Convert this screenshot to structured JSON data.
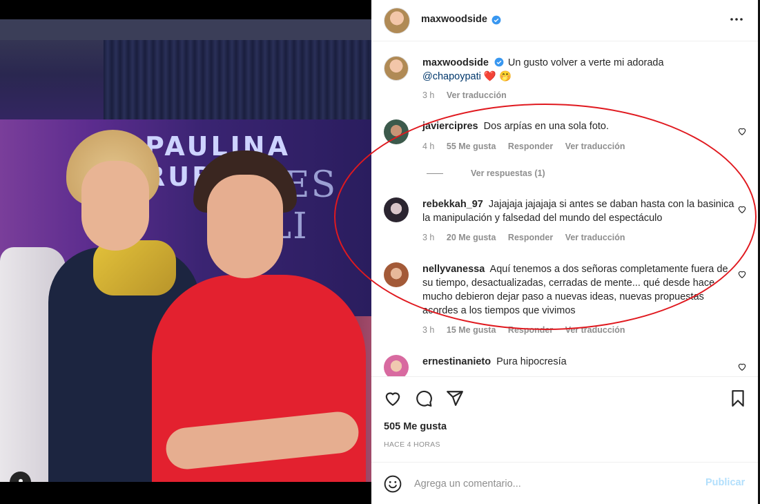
{
  "post": {
    "username": "maxwoodside",
    "caption_user": "maxwoodside",
    "caption_text": "Un gusto volver a verte mi adorada",
    "caption_mention": "@chapoypati",
    "caption_emojis": "❤️ 🤭",
    "caption_time": "3 h",
    "caption_translate": "Ver traducción",
    "photo_poster_line1": "PAULINA RUB",
    "photo_poster_line2": "NO ES CULI"
  },
  "comments": [
    {
      "user": "javiercipres",
      "text": "Dos arpías en una sola foto.",
      "time": "4 h",
      "likes": "55 Me gusta",
      "reply": "Responder",
      "translate": "Ver traducción"
    },
    {
      "user": "rebekkah_97",
      "text": "Jajajaja jajajaja si antes se daban hasta con la basinica la manipulación y falsedad del mundo del espectáculo",
      "time": "3 h",
      "likes": "20 Me gusta",
      "reply": "Responder",
      "translate": "Ver traducción"
    },
    {
      "user": "nellyvanessa",
      "text": "Aquí tenemos a dos señoras completamente fuera de su tiempo, desactualizadas, cerradas de mente... qué desde hace mucho debieron dejar paso a nuevas ideas, nuevas propuestas acordes a los tiempos que vivimos",
      "time": "3 h",
      "likes": "15 Me gusta",
      "reply": "Responder",
      "translate": "Ver traducción"
    },
    {
      "user": "ernestinanieto",
      "text": "Pura hipocresía"
    }
  ],
  "replies_link": "Ver respuestas (1)",
  "footer": {
    "likes": "505 Me gusta",
    "time_ago": "HACE 4 HORAS",
    "comment_placeholder": "Agrega un comentario...",
    "post_label": "Publicar"
  },
  "colors": {
    "verified": "#3897f0",
    "link": "#00376b",
    "highlight_ellipse": "#e0191f",
    "publish_disabled": "#b2dffc"
  },
  "icons": [
    "heart-icon",
    "comment-icon",
    "share-icon",
    "bookmark-icon",
    "emoji-icon",
    "more-icon",
    "verified-icon",
    "user-tag-icon"
  ]
}
